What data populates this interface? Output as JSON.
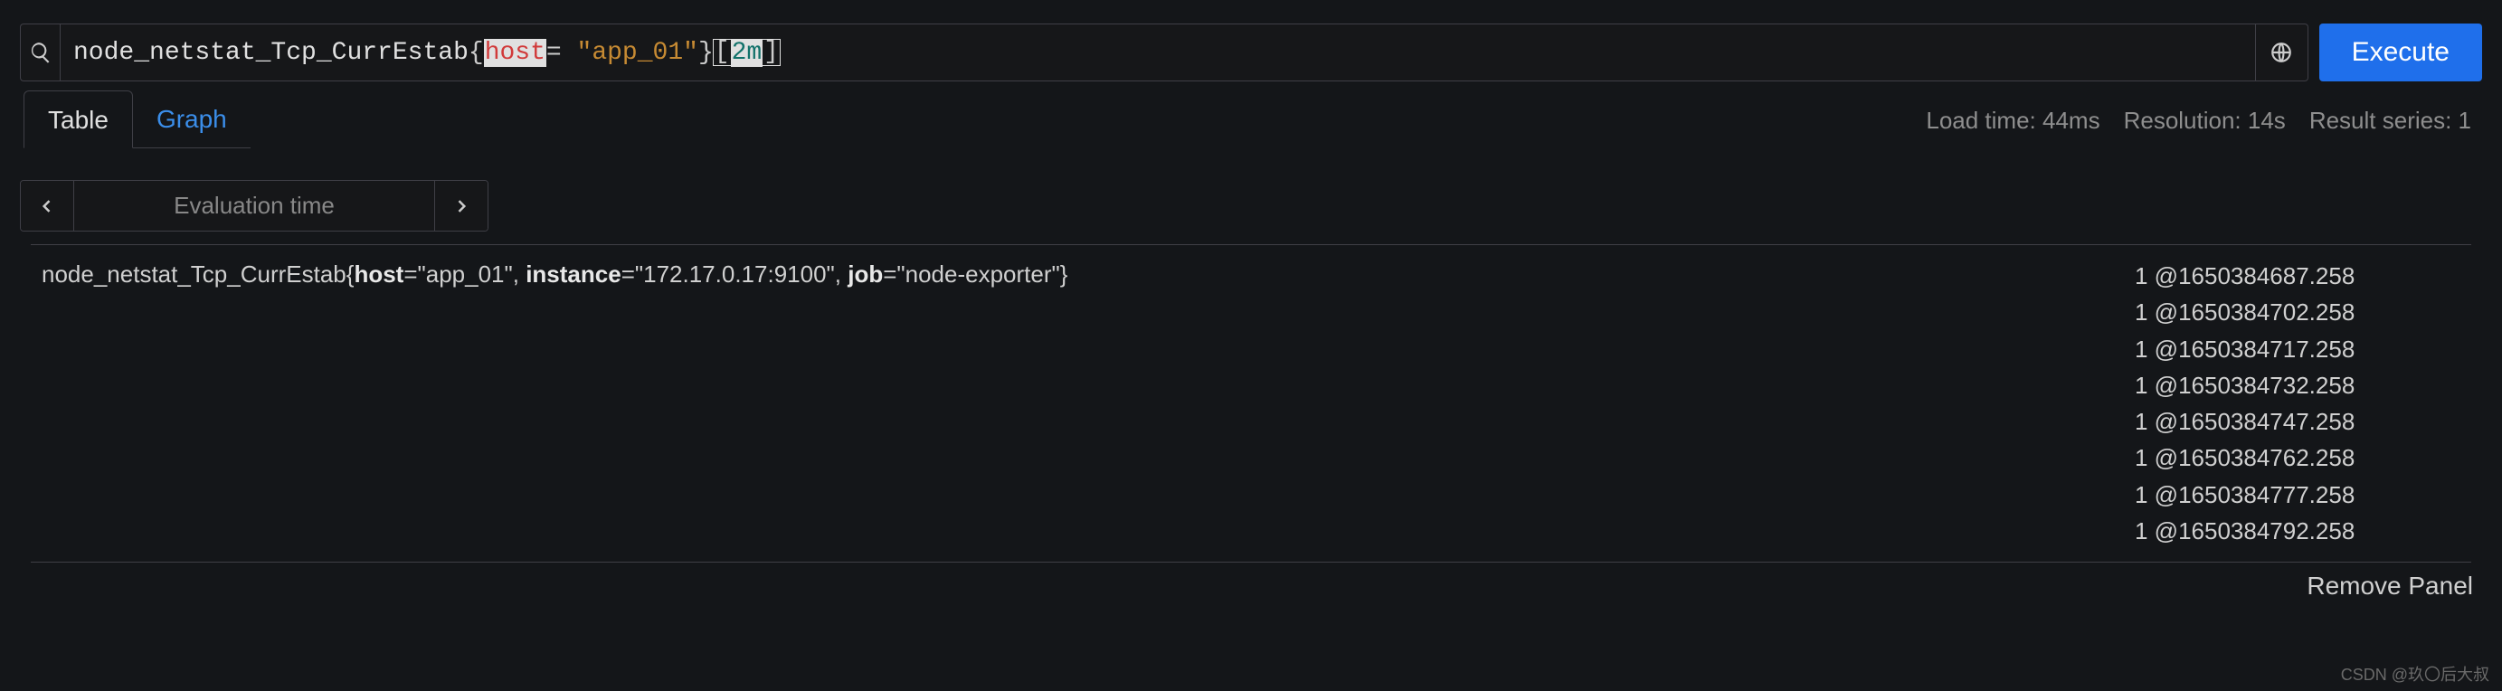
{
  "query": {
    "metric": "node_netstat_Tcp_CurrEstab",
    "label_name": "host",
    "label_value": "\"app_01\"",
    "range": "2m"
  },
  "buttons": {
    "execute": "Execute",
    "remove_panel": "Remove Panel"
  },
  "tabs": {
    "table": "Table",
    "graph": "Graph"
  },
  "stats": {
    "load_time": "Load time: 44ms",
    "resolution": "Resolution: 14s",
    "series": "Result series: 1"
  },
  "time": {
    "placeholder": "Evaluation time"
  },
  "result": {
    "metric_name": "node_netstat_Tcp_CurrEstab",
    "labels": {
      "host": "app_01",
      "instance": "172.17.0.17:9100",
      "job": "node-exporter"
    },
    "values": [
      "1 @1650384687.258",
      "1 @1650384702.258",
      "1 @1650384717.258",
      "1 @1650384732.258",
      "1 @1650384747.258",
      "1 @1650384762.258",
      "1 @1650384777.258",
      "1 @1650384792.258"
    ]
  },
  "watermark": "CSDN @玖〇后大叔"
}
